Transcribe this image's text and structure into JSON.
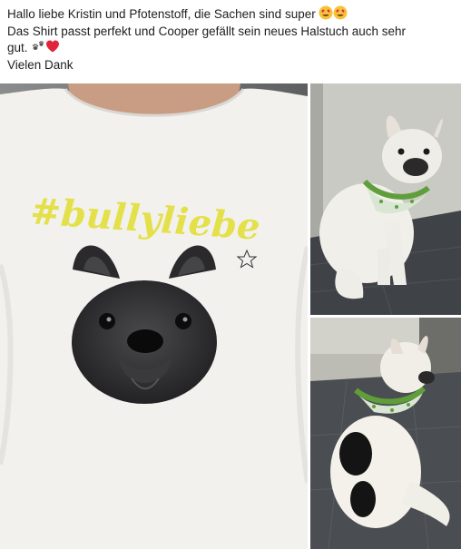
{
  "post": {
    "line1": "Hallo liebe Kristin und Pfotenstoff, die Sachen sind super",
    "line2": "Das Shirt passt perfekt und Cooper gefällt sein neues Halstuch auch sehr",
    "line3": "gut.",
    "line4": "Vielen Dank"
  },
  "photos": {
    "main": {
      "shirt_print_text": "#bullyliebe"
    }
  },
  "icons": {
    "heart_eyes_emoji": "heart-eyes-emoji",
    "paw_prints_emoji": "paw-prints-emoji",
    "red_heart_emoji": "red-heart-emoji"
  },
  "colors": {
    "text": "#1c1e21",
    "print_yellow": "#e3e04a",
    "bandana_green": "#5f9e3a"
  }
}
